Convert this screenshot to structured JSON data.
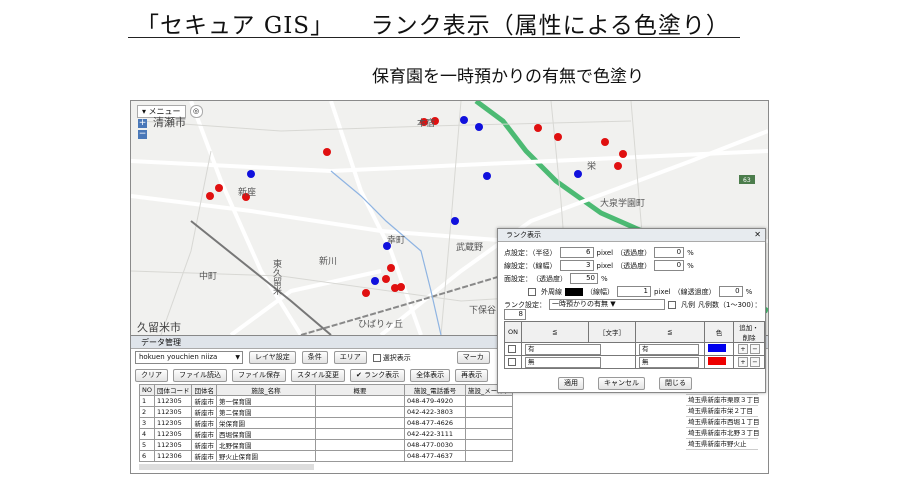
{
  "header": {
    "title_prefix": "「セキュア GIS」",
    "title_main": "ランク表示（属性による色塗り）",
    "subtitle": "保育園を一時預かりの有無で色塗り"
  },
  "map": {
    "menu_label": "▾ メニュー",
    "zoom_in": "+",
    "zoom_out": "−",
    "route_badge": "63",
    "place_labels": [
      "清瀬市",
      "新座",
      "本宿",
      "栄",
      "大泉学園町",
      "新川",
      "武蔵野",
      "東久留米",
      "久留米市",
      "ひばりヶ丘",
      "中町",
      "幸町",
      "下保谷"
    ],
    "dot_colors": {
      "red": "#e01010",
      "blue": "#1010dd"
    }
  },
  "data_manager": {
    "title": "データ管理",
    "layer_select": "hokuen youchien niiza",
    "layer_settings": "レイヤ設定",
    "condition": "条件",
    "area": "エリア",
    "select_display": "選択表示",
    "marker": "マーカ",
    "buttons": [
      "クリア",
      "ファイル読込",
      "ファイル保存",
      "スタイル変更",
      "ランク表示",
      "全体表示",
      "再表示"
    ],
    "columns": [
      "NO",
      "団体コード",
      "団体名",
      "施設_名称",
      "概要",
      "施設_電話番号",
      "施設_メールア"
    ],
    "rows": [
      [
        "1",
        "112305",
        "新座市",
        "第一保育園",
        "",
        "048-479-4920"
      ],
      [
        "2",
        "112305",
        "新座市",
        "第二保育園",
        "",
        "042-422-3803"
      ],
      [
        "3",
        "112305",
        "新座市",
        "栄保育園",
        "",
        "048-477-4626"
      ],
      [
        "4",
        "112305",
        "新座市",
        "西堀保育園",
        "",
        "042-422-3111"
      ],
      [
        "5",
        "112305",
        "新座市",
        "北野保育園",
        "",
        "048-477-0030"
      ],
      [
        "6",
        "112306",
        "新座市",
        "野火止保育園",
        "",
        "048-477-4637"
      ]
    ],
    "addresses": [
      "埼玉県新座市東１丁目",
      "埼玉県新座市栗原３丁目",
      "埼玉県新座市栄２丁目",
      "埼玉県新座市西堀１丁目",
      "埼玉県新座市北野３丁目",
      "埼玉県新座市野火止"
    ]
  },
  "rank_dialog": {
    "title": "ランク表示",
    "close": "✕",
    "point_setting": "点設定：（半径）",
    "radius": "6",
    "pixel": "pixel",
    "transparency": "（透過度）",
    "point_trans": "0",
    "percent": "%",
    "line_setting": "線設定：（線幅）",
    "line_width": "3",
    "line_trans": "0",
    "area_setting": "面設定：　（透過度）",
    "area_trans": "50",
    "outline_label": "外周線",
    "outline_width_label": "（線幅）",
    "outline_width": "1",
    "outline_trans_label": "（線透過度）",
    "outline_trans": "0",
    "rank_setting": "ランク設定：",
    "rank_field": "一時預かりの有無",
    "legend_label": "凡例",
    "legend_count": "凡例数（1〜300）：",
    "legend_value": "8",
    "col_on": "ON",
    "col_le": "≦",
    "col_text": "［文字］",
    "col_le2": "≦",
    "col_color": "色",
    "col_edit": "追加・削除",
    "rules": [
      {
        "from": "有",
        "to": "有",
        "color": "#0000ee"
      },
      {
        "from": "無",
        "to": "無",
        "color": "#ee0000"
      }
    ],
    "apply": "適用",
    "cancel": "キャンセル",
    "close_btn": "閉じる"
  }
}
